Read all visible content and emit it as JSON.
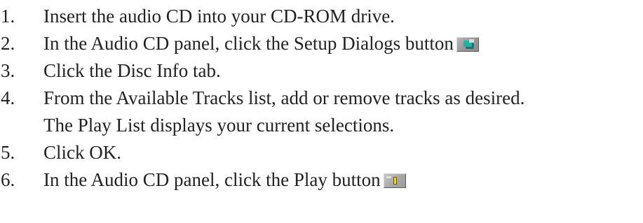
{
  "top_fragment": "... ...",
  "steps": [
    {
      "number": "1.",
      "lines": [
        "Insert the audio CD into your CD-ROM drive."
      ]
    },
    {
      "number": "2.",
      "lines": [
        "In the Audio CD panel, click the Setup Dialogs button"
      ],
      "icon": "setup-dialogs-icon"
    },
    {
      "number": "3.",
      "lines": [
        "Click the Disc Info tab."
      ]
    },
    {
      "number": "4.",
      "lines": [
        "From the Available Tracks list, add or remove tracks as desired.",
        "The Play List displays your current selections."
      ]
    },
    {
      "number": "5.",
      "lines": [
        "Click OK."
      ]
    },
    {
      "number": "6.",
      "lines": [
        "In the Audio CD panel, click the Play button"
      ],
      "icon": "play-icon"
    }
  ]
}
